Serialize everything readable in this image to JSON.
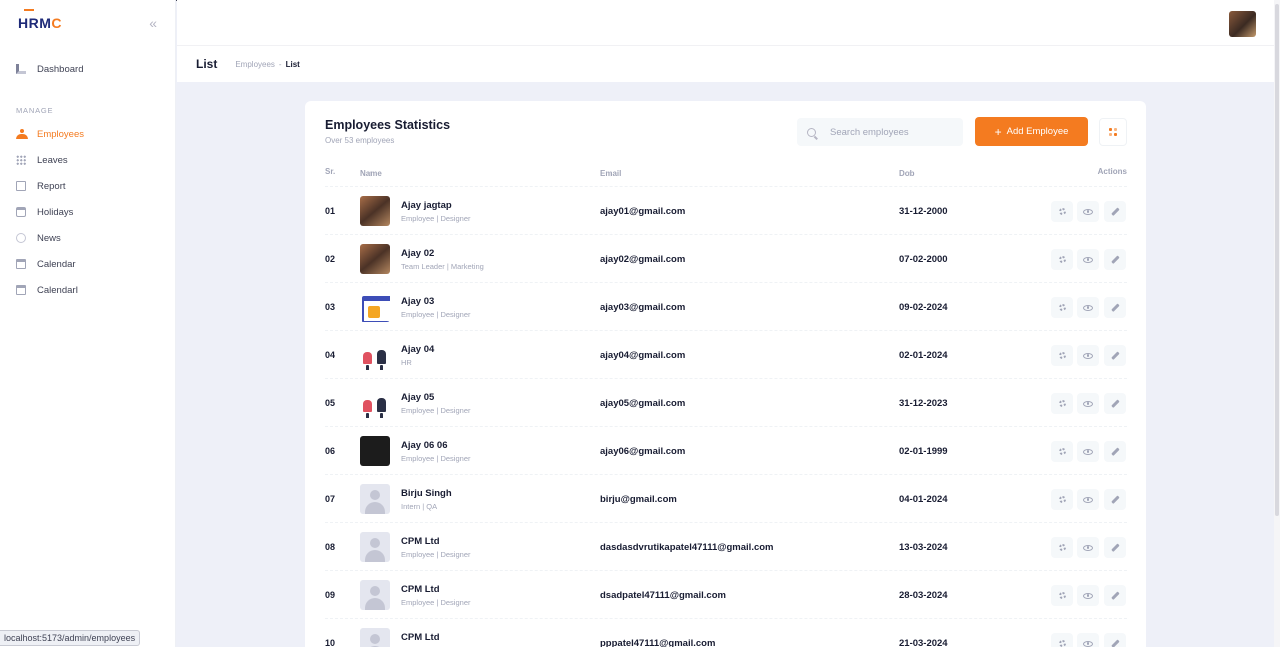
{
  "brand": {
    "logo_main": "HRM",
    "logo_accent": "C"
  },
  "sidebar": {
    "items_top": [
      {
        "label": "Dashboard",
        "icon": "dashboard-icon"
      }
    ],
    "section_label": "MANAGE",
    "items": [
      {
        "label": "Employees",
        "icon": "employees-icon",
        "active": true
      },
      {
        "label": "Leaves",
        "icon": "leaves-icon"
      },
      {
        "label": "Report",
        "icon": "report-icon"
      },
      {
        "label": "Holidays",
        "icon": "holidays-icon"
      },
      {
        "label": "News",
        "icon": "news-icon"
      },
      {
        "label": "Calendar",
        "icon": "calendar-icon"
      },
      {
        "label": "CalendarI",
        "icon": "calendar-icon"
      }
    ]
  },
  "subheader": {
    "title": "List",
    "breadcrumb": [
      "Employees",
      "List"
    ],
    "breadcrumb_sep": "-"
  },
  "card": {
    "title": "Employees Statistics",
    "subtitle": "Over 53 employees",
    "search_placeholder": "Search employees",
    "add_label": "Add Employee"
  },
  "table": {
    "headers": {
      "sr": "Sr.",
      "name": "Name",
      "email": "Email",
      "dob": "Dob",
      "actions": "Actions"
    },
    "sort_glyph": "↑",
    "rows": [
      {
        "sr": "01",
        "name": "Ajay jagtap",
        "role": "Employee | Designer",
        "email": "ajay01@gmail.com",
        "dob": "31-12-2000",
        "avatar": "photo"
      },
      {
        "sr": "02",
        "name": "Ajay 02",
        "role": "Team Leader | Marketing",
        "email": "ajay02@gmail.com",
        "dob": "07-02-2000",
        "avatar": "photo"
      },
      {
        "sr": "03",
        "name": "Ajay 03",
        "role": "Employee | Designer",
        "email": "ajay03@gmail.com",
        "dob": "09-02-2024",
        "avatar": "calendar"
      },
      {
        "sr": "04",
        "name": "Ajay 04",
        "role": "HR",
        "email": "ajay04@gmail.com",
        "dob": "02-01-2024",
        "avatar": "meeting"
      },
      {
        "sr": "05",
        "name": "Ajay 05",
        "role": "Employee | Designer",
        "email": "ajay05@gmail.com",
        "dob": "31-12-2023",
        "avatar": "meeting"
      },
      {
        "sr": "06",
        "name": "Ajay 06 06",
        "role": "Employee | Designer",
        "email": "ajay06@gmail.com",
        "dob": "02-01-1999",
        "avatar": "dark"
      },
      {
        "sr": "07",
        "name": "Birju Singh",
        "role": "Intern | QA",
        "email": "birju@gmail.com",
        "dob": "04-01-2024",
        "avatar": "blank"
      },
      {
        "sr": "08",
        "name": "CPM Ltd",
        "role": "Employee | Designer",
        "email": "dasdasdvrutikapatel47111@gmail.com",
        "dob": "13-03-2024",
        "avatar": "blank"
      },
      {
        "sr": "09",
        "name": "CPM Ltd",
        "role": "Employee | Designer",
        "email": "dsadpatel47111@gmail.com",
        "dob": "28-03-2024",
        "avatar": "blank"
      },
      {
        "sr": "10",
        "name": "CPM Ltd",
        "role": "",
        "email": "pppatel47111@gmail.com",
        "dob": "21-03-2024",
        "avatar": "blank"
      }
    ]
  },
  "status_url": "localhost:5173/admin/employees",
  "colors": {
    "accent": "#f47b20",
    "background": "#eef0f8",
    "text": "#181c32",
    "muted": "#a1a5b7"
  }
}
